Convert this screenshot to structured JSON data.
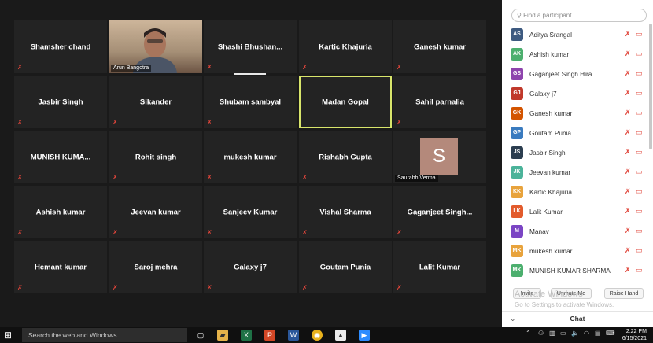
{
  "gallery": {
    "tiles": [
      {
        "name": "Shamsher chand"
      },
      {
        "name": "Arun Bangotra"
      },
      {
        "name": "Shashi  Bhushan..."
      },
      {
        "name": "Kartic Khajuria"
      },
      {
        "name": "Ganesh kumar"
      },
      {
        "name": "Jasbir Singh"
      },
      {
        "name": "Sikander"
      },
      {
        "name": "Shubam sambyal"
      },
      {
        "name": "Madan Gopal"
      },
      {
        "name": "Sahil parnalia"
      },
      {
        "name": "MUNISH  KUMA..."
      },
      {
        "name": "Rohit singh"
      },
      {
        "name": "mukesh kumar"
      },
      {
        "name": "Rishabh Gupta"
      },
      {
        "name": "Saurabh Verma",
        "avatar_letter": "S"
      },
      {
        "name": "Ashish kumar"
      },
      {
        "name": "Jeevan kumar"
      },
      {
        "name": "Sanjeev Kumar"
      },
      {
        "name": "Vishal Sharma"
      },
      {
        "name": "Gaganjeet  Singh..."
      },
      {
        "name": "Hemant kumar"
      },
      {
        "name": "Saroj mehra"
      },
      {
        "name": "Galaxy j7"
      },
      {
        "name": "Goutam Punia"
      },
      {
        "name": "Lalit Kumar"
      }
    ]
  },
  "participants": {
    "search_placeholder": "Find a participant",
    "items": [
      {
        "initials": "AS",
        "name": "Aditya Srangal",
        "color": "#3d5a80"
      },
      {
        "initials": "AK",
        "name": "Ashish kumar",
        "color": "#4caf6e"
      },
      {
        "initials": "GS",
        "name": "Gaganjeet Singh Hira",
        "color": "#8e44ad"
      },
      {
        "initials": "GJ",
        "name": "Galaxy j7",
        "color": "#c0392b"
      },
      {
        "initials": "GK",
        "name": "Ganesh kumar",
        "color": "#d35400"
      },
      {
        "initials": "GP",
        "name": "Goutam Punia",
        "color": "#3a7bbf"
      },
      {
        "initials": "JS",
        "name": "Jasbir Singh",
        "color": "#2c3e50"
      },
      {
        "initials": "JK",
        "name": "Jeevan kumar",
        "color": "#4bb39a"
      },
      {
        "initials": "KK",
        "name": "Kartic Khajuria",
        "color": "#e8a33c"
      },
      {
        "initials": "LK",
        "name": "Lalit Kumar",
        "color": "#e25b2c"
      },
      {
        "initials": "M",
        "name": "Manav",
        "color": "#7b45c4"
      },
      {
        "initials": "MK",
        "name": "mukesh kumar",
        "color": "#e8a33c"
      },
      {
        "initials": "MK",
        "name": "MUNISH KUMAR SHARMA",
        "color": "#4caf6e"
      }
    ],
    "buttons": {
      "invite": "Invite",
      "unmute": "Unmute Me",
      "raise_hand": "Raise Hand"
    },
    "watermark": "Activate Windows",
    "watermark_sub": "Go to Settings to activate Windows.",
    "chat_label": "Chat"
  },
  "taskbar": {
    "search_placeholder": "Search the web and Windows",
    "time": "2:22 PM",
    "date": "6/15/2021"
  }
}
